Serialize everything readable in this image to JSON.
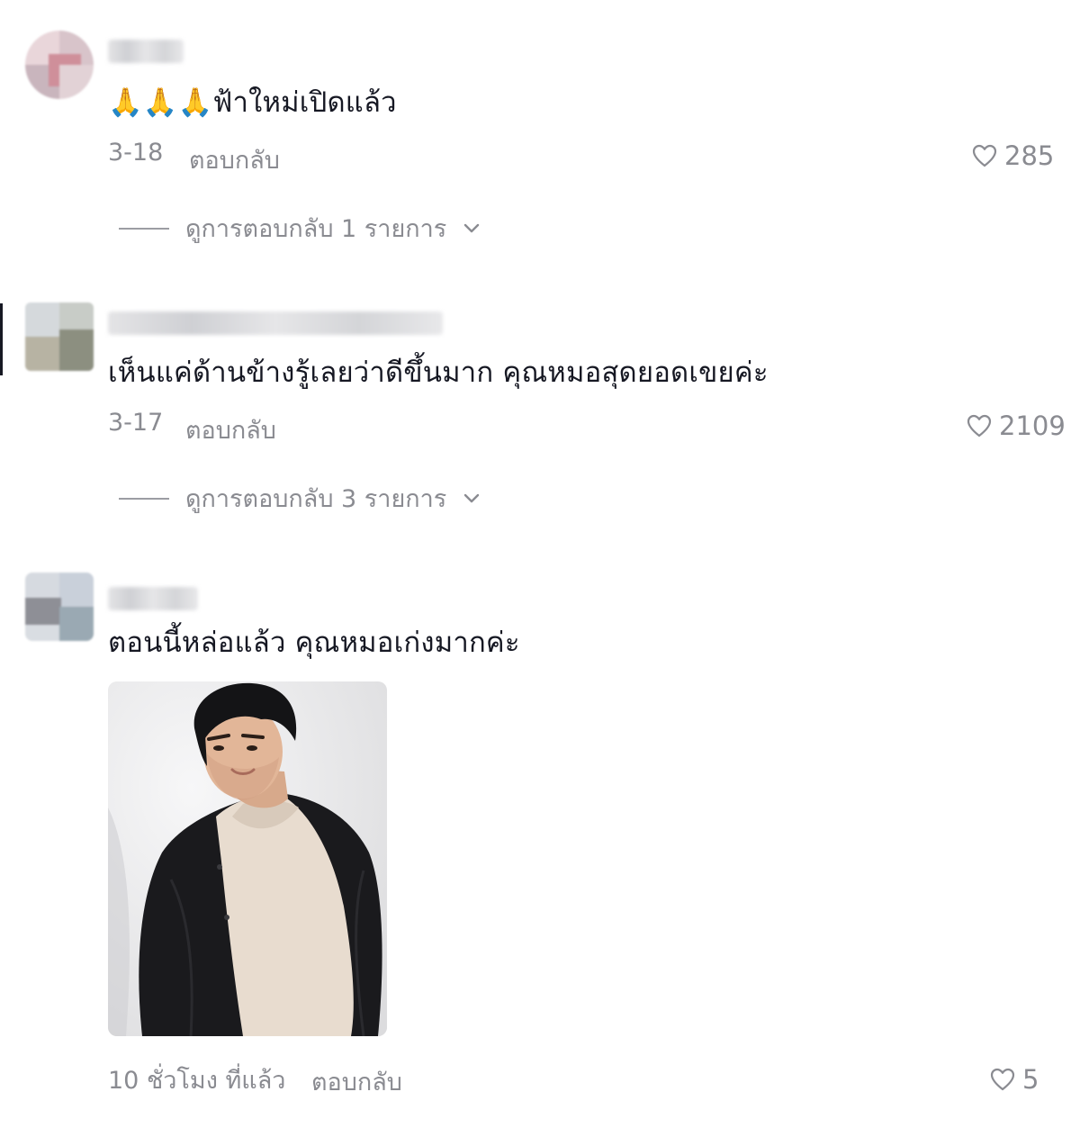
{
  "comments": [
    {
      "emoji": "🙏🙏🙏",
      "text": "ฟ้าใหม่เปิดแล้ว",
      "date": "3-18",
      "reply_label": "ตอบกลับ",
      "likes": "285",
      "view_replies": "ดูการตอบกลับ 1 รายการ"
    },
    {
      "text": "เห็นแค่ด้านข้างรู้เลยว่าดีขึ้นมาก คุณหมอสุดยอดเขยค่ะ",
      "date": "3-17",
      "reply_label": "ตอบกลับ",
      "likes": "2109",
      "view_replies": "ดูการตอบกลับ 3 รายการ"
    },
    {
      "text": "ตอนนี้หล่อแล้ว คุณหมอเก่งมากค่ะ",
      "date": "10 ชั่วโมง ที่แล้ว",
      "reply_label": "ตอบกลับ",
      "likes": "5"
    }
  ],
  "icons": {
    "like": "heart-outline-icon",
    "expand": "chevron-down-icon"
  },
  "colors": {
    "text": "#161823",
    "meta": "#8a8b91"
  }
}
